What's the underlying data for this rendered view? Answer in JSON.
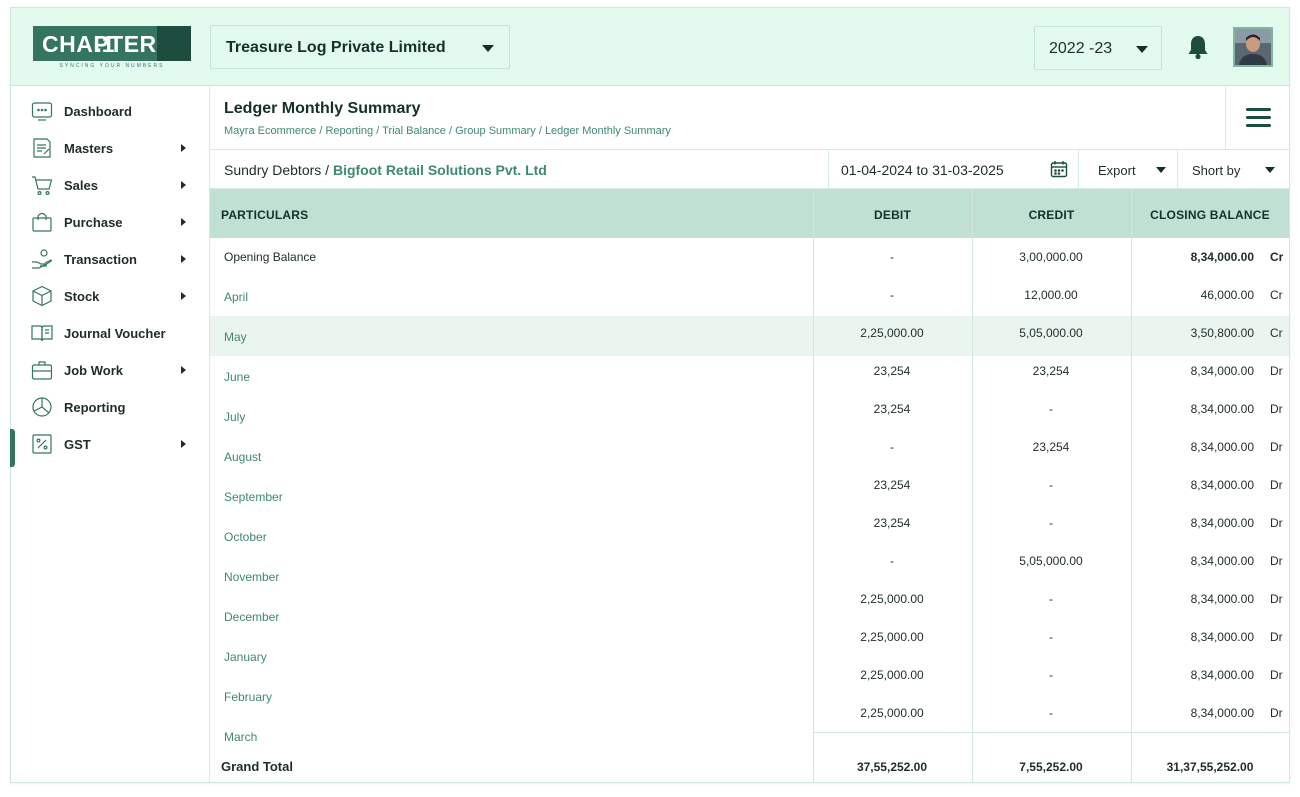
{
  "header": {
    "logo_word": "CHAPTER",
    "logo_num": ".1",
    "logo_tagline": "SYNCING YOUR NUMBERS",
    "company": "Treasure Log Private Limited",
    "year": "2022 -23"
  },
  "sidebar": {
    "items": [
      {
        "label": "Dashboard",
        "icon": "dashboard-icon",
        "arrow": false
      },
      {
        "label": "Masters",
        "icon": "masters-icon",
        "arrow": true
      },
      {
        "label": "Sales",
        "icon": "cart-icon",
        "arrow": true
      },
      {
        "label": "Purchase",
        "icon": "bag-icon",
        "arrow": true
      },
      {
        "label": "Transaction",
        "icon": "hand-coin-icon",
        "arrow": true
      },
      {
        "label": "Stock",
        "icon": "box-icon",
        "arrow": true
      },
      {
        "label": "Journal Voucher",
        "icon": "book-icon",
        "arrow": false
      },
      {
        "label": "Job Work",
        "icon": "briefcase-icon",
        "arrow": true
      },
      {
        "label": "Reporting",
        "icon": "pie-icon",
        "arrow": false
      },
      {
        "label": "GST",
        "icon": "percent-icon",
        "arrow": true
      }
    ],
    "active": "GST"
  },
  "page": {
    "title": "Ledger Monthly Summary",
    "breadcrumb": "Mayra Ecommerce / Reporting / Trial Balance / Group Summary / Ledger Monthly Summary",
    "group": "Sundry Debtors /",
    "ledger": "Bigfoot Retail Solutions Pvt. Ltd",
    "date_range": "01-04-2024 to 31-03-2025",
    "export_label": "Export",
    "sort_label": "Short by"
  },
  "table": {
    "headers": {
      "particulars": "PARTICULARS",
      "debit": "DEBIT",
      "credit": "CREDIT",
      "closing": "CLOSING BALANCE"
    },
    "particulars": [
      "Opening Balance",
      "April",
      "May",
      "June",
      "July",
      "August",
      "September",
      "October",
      "November",
      "December",
      "January",
      "February",
      "March"
    ],
    "amounts": [
      {
        "debit": "-",
        "credit": "3,00,000.00",
        "closing": "8,34,000.00",
        "type": "Cr"
      },
      {
        "debit": "-",
        "credit": "12,000.00",
        "closing": "46,000.00",
        "type": "Cr"
      },
      {
        "debit": "2,25,000.00",
        "credit": "5,05,000.00",
        "closing": "3,50,800.00",
        "type": "Cr"
      },
      {
        "debit": "23,254",
        "credit": "23,254",
        "closing": "8,34,000.00",
        "type": "Dr"
      },
      {
        "debit": "23,254",
        "credit": "-",
        "closing": "8,34,000.00",
        "type": "Dr"
      },
      {
        "debit": "-",
        "credit": "23,254",
        "closing": "8,34,000.00",
        "type": "Dr"
      },
      {
        "debit": "23,254",
        "credit": "-",
        "closing": "8,34,000.00",
        "type": "Dr"
      },
      {
        "debit": "23,254",
        "credit": "-",
        "closing": "8,34,000.00",
        "type": "Dr"
      },
      {
        "debit": "-",
        "credit": "5,05,000.00",
        "closing": "8,34,000.00",
        "type": "Dr"
      },
      {
        "debit": "2,25,000.00",
        "credit": "-",
        "closing": "8,34,000.00",
        "type": "Dr"
      },
      {
        "debit": "2,25,000.00",
        "credit": "-",
        "closing": "8,34,000.00",
        "type": "Dr"
      },
      {
        "debit": "2,25,000.00",
        "credit": "-",
        "closing": "8,34,000.00",
        "type": "Dr"
      },
      {
        "debit": "2,25,000.00",
        "credit": "-",
        "closing": "8,34,000.00",
        "type": "Dr"
      }
    ],
    "highlight_row": "May",
    "total": {
      "label": "Grand Total",
      "debit": "37,55,252.00",
      "credit": "7,55,252.00",
      "closing": "31,37,55,252.00"
    }
  },
  "colors": {
    "accent": "#35755f",
    "header_bg": "#e3fbee",
    "table_head": "#bfe0d2",
    "link": "#3e8a6c"
  }
}
